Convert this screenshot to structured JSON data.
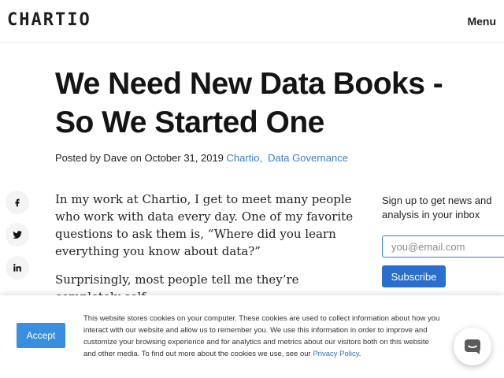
{
  "header": {
    "logo": "CHARTIO",
    "menu_label": "Menu"
  },
  "article": {
    "title": "We Need New Data Books - So We Started One",
    "meta_prefix": "Posted by Dave on October 31, 2019 ",
    "categories": [
      "Chartio",
      "Data Governance"
    ],
    "category_separator": ",",
    "paragraphs": [
      "In my work at Chartio, I get to meet many people who work with data every day. One of my favorite questions to ask them is, “Where did you learn everything you know about data?”",
      "Surprisingly, most people tell me they’re completely self-"
    ]
  },
  "share": [
    {
      "name": "facebook-icon",
      "glyph": "f"
    },
    {
      "name": "twitter-icon",
      "glyph": "t"
    },
    {
      "name": "linkedin-icon",
      "glyph": "in"
    }
  ],
  "signup": {
    "text": "Sign up to get news and analysis in your inbox",
    "email_placeholder": "you@email.com",
    "subscribe_label": "Subscribe"
  },
  "cookie_banner": {
    "accept_label": "Accept",
    "text": "This website stores cookies on your computer. These cookies are used to collect information about how you interact with our website and allow us to remember you. We use this information in order to improve and customize your browsing experience and for analytics and metrics about our visitors both on this website and other media. To find out more about the cookies we use, see our ",
    "policy_link": "Privacy Policy",
    "text_end": "."
  },
  "colors": {
    "link": "#3a7bd5",
    "accent_button": "#2b6fce",
    "accept_button": "#3a8ee0"
  }
}
